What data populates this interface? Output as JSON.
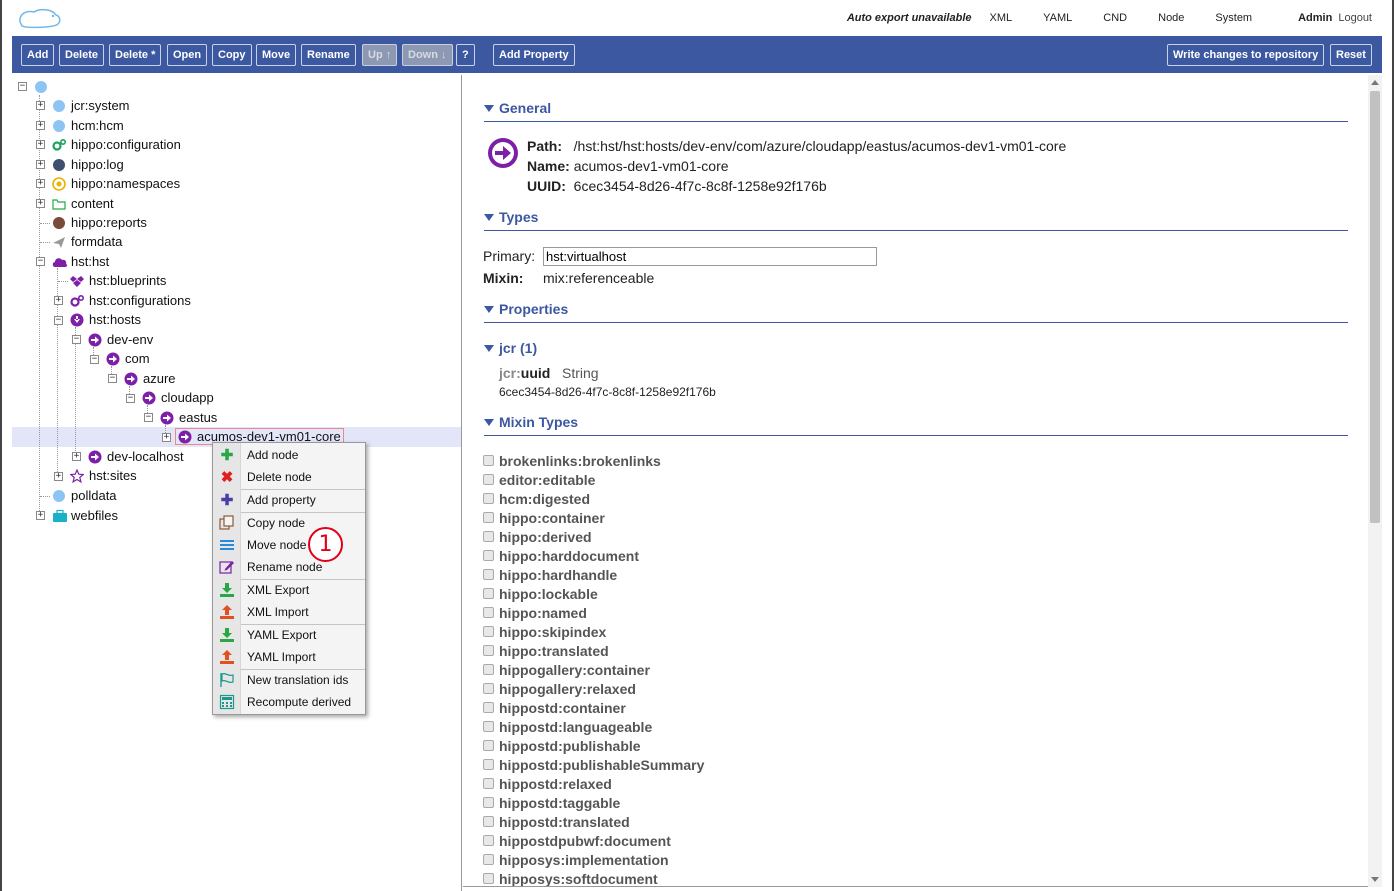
{
  "topbar": {
    "auto_export": "Auto export unavailable",
    "links": [
      "XML",
      "YAML",
      "CND",
      "Node",
      "System"
    ],
    "user": "Admin",
    "logout": "Logout"
  },
  "toolbar": {
    "add": "Add",
    "delete": "Delete",
    "delete_star": "Delete *",
    "open": "Open",
    "copy": "Copy",
    "move": "Move",
    "rename": "Rename",
    "up": "Up ↑",
    "down": "Down ↓",
    "help": "?",
    "add_property": "Add Property",
    "write_changes": "Write changes to repository",
    "reset": "Reset"
  },
  "tree": {
    "nodes": [
      {
        "label": "jcr:system",
        "icon": "circle-icon",
        "color": "#8ec4f4"
      },
      {
        "label": "hcm:hcm",
        "icon": "circle-icon",
        "color": "#8ec4f4"
      },
      {
        "label": "hippo:configuration",
        "icon": "gears-icon",
        "color": "#1aa35a"
      },
      {
        "label": "hippo:log",
        "icon": "circle-icon",
        "color": "#3f4f6e"
      },
      {
        "label": "hippo:namespaces",
        "icon": "target-icon",
        "color": "#e6b400"
      },
      {
        "label": "content",
        "icon": "folder-icon",
        "color": "#22aa44"
      },
      {
        "label": "hippo:reports",
        "icon": "circle-icon",
        "color": "#7a4a3a"
      },
      {
        "label": "formdata",
        "icon": "paper-plane-icon",
        "color": "#777777"
      },
      {
        "label": "hst:hst",
        "icon": "cloud-icon",
        "color": "#7d1fa8"
      },
      {
        "label": "hst:blueprints",
        "icon": "dropbox-icon",
        "color": "#7d1fa8"
      },
      {
        "label": "hst:configurations",
        "icon": "gears-icon",
        "color": "#7d1fa8"
      },
      {
        "label": "hst:hosts",
        "icon": "down-arrow-circle-icon",
        "color": "#7d1fa8"
      },
      {
        "label": "dev-env",
        "icon": "arrow-circle-icon",
        "color": "#7d1fa8"
      },
      {
        "label": "com",
        "icon": "arrow-circle-icon",
        "color": "#7d1fa8"
      },
      {
        "label": "azure",
        "icon": "arrow-circle-icon",
        "color": "#7d1fa8"
      },
      {
        "label": "cloudapp",
        "icon": "arrow-circle-icon",
        "color": "#7d1fa8"
      },
      {
        "label": "eastus",
        "icon": "arrow-circle-icon",
        "color": "#7d1fa8"
      },
      {
        "label": "acumos-dev1-vm01-core",
        "icon": "arrow-circle-icon",
        "color": "#7d1fa8"
      },
      {
        "label": "dev-localhost",
        "icon": "arrow-circle-icon",
        "color": "#7d1fa8"
      },
      {
        "label": "hst:sites",
        "icon": "star-icon",
        "color": "#7d1fa8"
      },
      {
        "label": "polldata",
        "icon": "circle-icon",
        "color": "#8ec4f4"
      },
      {
        "label": "webfiles",
        "icon": "briefcase-icon",
        "color": "#1ab0c8"
      }
    ]
  },
  "context_menu": {
    "items": [
      {
        "label": "Add node",
        "icon": "plus-icon",
        "color": "#2aa745"
      },
      {
        "label": "Delete node",
        "icon": "x-icon",
        "color": "#e02020"
      },
      {
        "label": "Add property",
        "icon": "plus-icon",
        "color": "#4a3fa8"
      },
      {
        "label": "Copy node",
        "icon": "copy-icon",
        "color": "#8a5a3a"
      },
      {
        "label": "Move node",
        "icon": "bars-icon",
        "color": "#2a8ad8"
      },
      {
        "label": "Rename node",
        "icon": "edit-icon",
        "color": "#7d1fa8"
      },
      {
        "label": "XML Export",
        "icon": "download-icon",
        "color": "#2aa745"
      },
      {
        "label": "XML Import",
        "icon": "upload-icon",
        "color": "#e05020"
      },
      {
        "label": "YAML Export",
        "icon": "download-icon",
        "color": "#2aa745"
      },
      {
        "label": "YAML Import",
        "icon": "upload-icon",
        "color": "#e05020"
      },
      {
        "label": "New translation ids",
        "icon": "flag-icon",
        "color": "#1a9a8a"
      },
      {
        "label": "Recompute derived",
        "icon": "calculator-icon",
        "color": "#1a9a8a"
      }
    ],
    "badge": "1"
  },
  "general": {
    "title": "General",
    "path_label": "Path:",
    "path": "/hst:hst/hst:hosts/dev-env/com/azure/cloudapp/eastus/acumos-dev1-vm01-core",
    "name_label": "Name:",
    "name": "acumos-dev1-vm01-core",
    "uuid_label": "UUID:",
    "uuid": "6cec3454-8d26-4f7c-8c8f-1258e92f176b"
  },
  "types": {
    "title": "Types",
    "primary_label": "Primary:",
    "primary": "hst:virtualhost",
    "mixin_label": "Mixin:",
    "mixin": "mix:referenceable"
  },
  "properties": {
    "title": "Properties",
    "group": "jcr (1)",
    "prop_prefix": "jcr:",
    "prop_name": "uuid",
    "prop_type": "String",
    "prop_value": "6cec3454-8d26-4f7c-8c8f-1258e92f176b"
  },
  "mixin_types": {
    "title": "Mixin Types",
    "items": [
      "brokenlinks:brokenlinks",
      "editor:editable",
      "hcm:digested",
      "hippo:container",
      "hippo:derived",
      "hippo:harddocument",
      "hippo:hardhandle",
      "hippo:lockable",
      "hippo:named",
      "hippo:skipindex",
      "hippo:translated",
      "hippogallery:container",
      "hippogallery:relaxed",
      "hippostd:container",
      "hippostd:languageable",
      "hippostd:publishable",
      "hippostd:publishableSummary",
      "hippostd:relaxed",
      "hippostd:taggable",
      "hippostd:translated",
      "hippostdpubwf:document",
      "hipposys:implementation",
      "hipposys:softdocument"
    ]
  }
}
